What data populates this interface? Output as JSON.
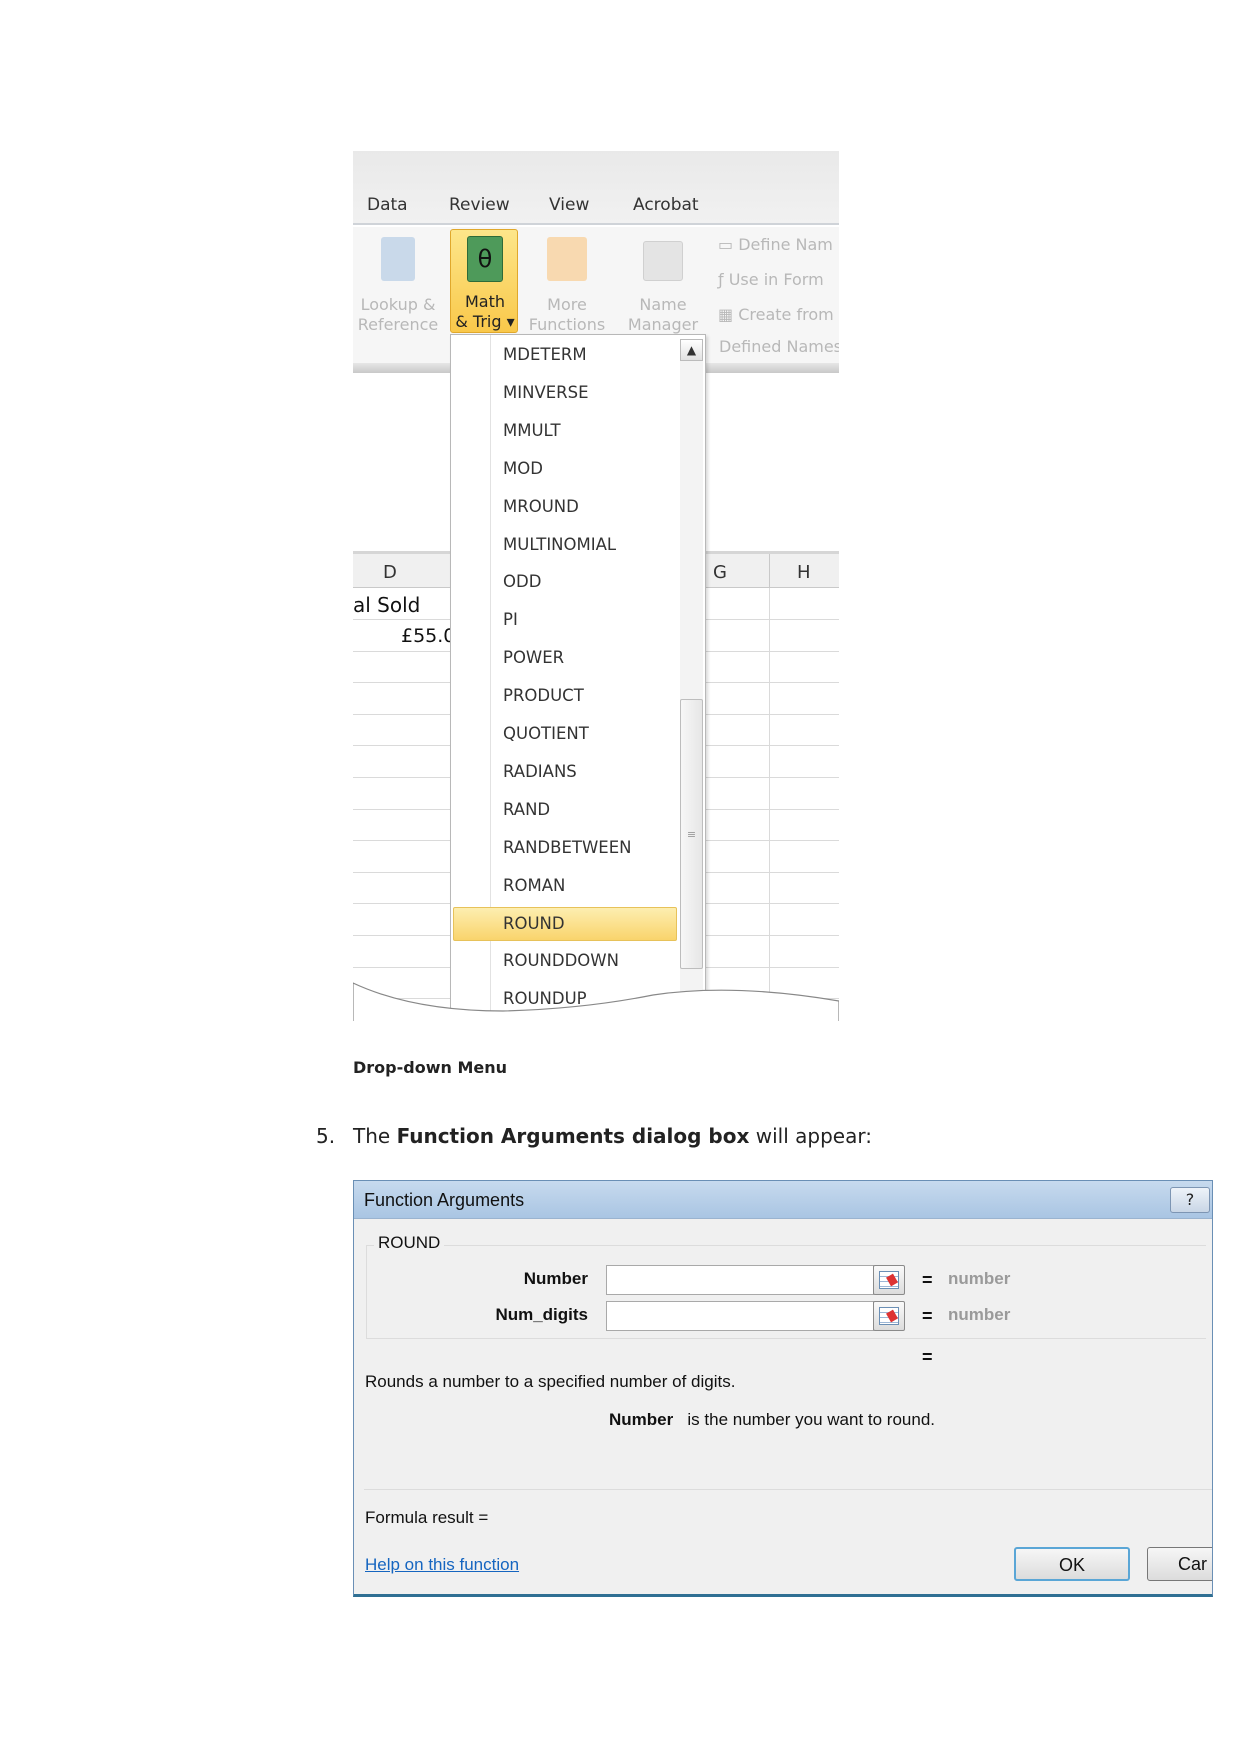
{
  "ribbon": {
    "tabs": [
      "Data",
      "Review",
      "View",
      "Acrobat"
    ],
    "buttons": {
      "lookup": [
        "Lookup &",
        "Reference"
      ],
      "math": [
        "Math",
        "& Trig"
      ],
      "more": [
        "More",
        "Functions"
      ],
      "name_manager": [
        "Name",
        "Manager"
      ]
    },
    "defined_names": {
      "define": "Define Nam",
      "use": "Use in Form",
      "create": "Create from",
      "group_label": "Defined Names"
    }
  },
  "sheet": {
    "columns": [
      "D",
      "G",
      "H"
    ],
    "cells": {
      "d1": "al Sold",
      "d2": "£55.0"
    }
  },
  "dropdown": {
    "items": [
      "MDETERM",
      "MINVERSE",
      "MMULT",
      "MOD",
      "MROUND",
      "MULTINOMIAL",
      "ODD",
      "PI",
      "POWER",
      "PRODUCT",
      "QUOTIENT",
      "RADIANS",
      "RAND",
      "RANDBETWEEN",
      "ROMAN",
      "ROUND",
      "ROUNDDOWN",
      "ROUNDUP"
    ],
    "selected": "ROUND"
  },
  "caption": "Drop-down Menu",
  "step": {
    "number": "5.",
    "pre": "The ",
    "bold": "Function Arguments dialog box",
    "post": " will appear:"
  },
  "dialog": {
    "title": "Function Arguments",
    "help_icon": "?",
    "function": "ROUND",
    "args": [
      {
        "label": "Number",
        "value": "",
        "result": "number"
      },
      {
        "label": "Num_digits",
        "value": "",
        "result": "number"
      }
    ],
    "eq": "=",
    "description": "Rounds a number to a specified number of digits.",
    "arg_help_name": "Number",
    "arg_help_text": "is the number you want to round.",
    "formula_result": "Formula result =",
    "help_link": "Help on this function",
    "ok": "OK",
    "cancel": "Car"
  }
}
